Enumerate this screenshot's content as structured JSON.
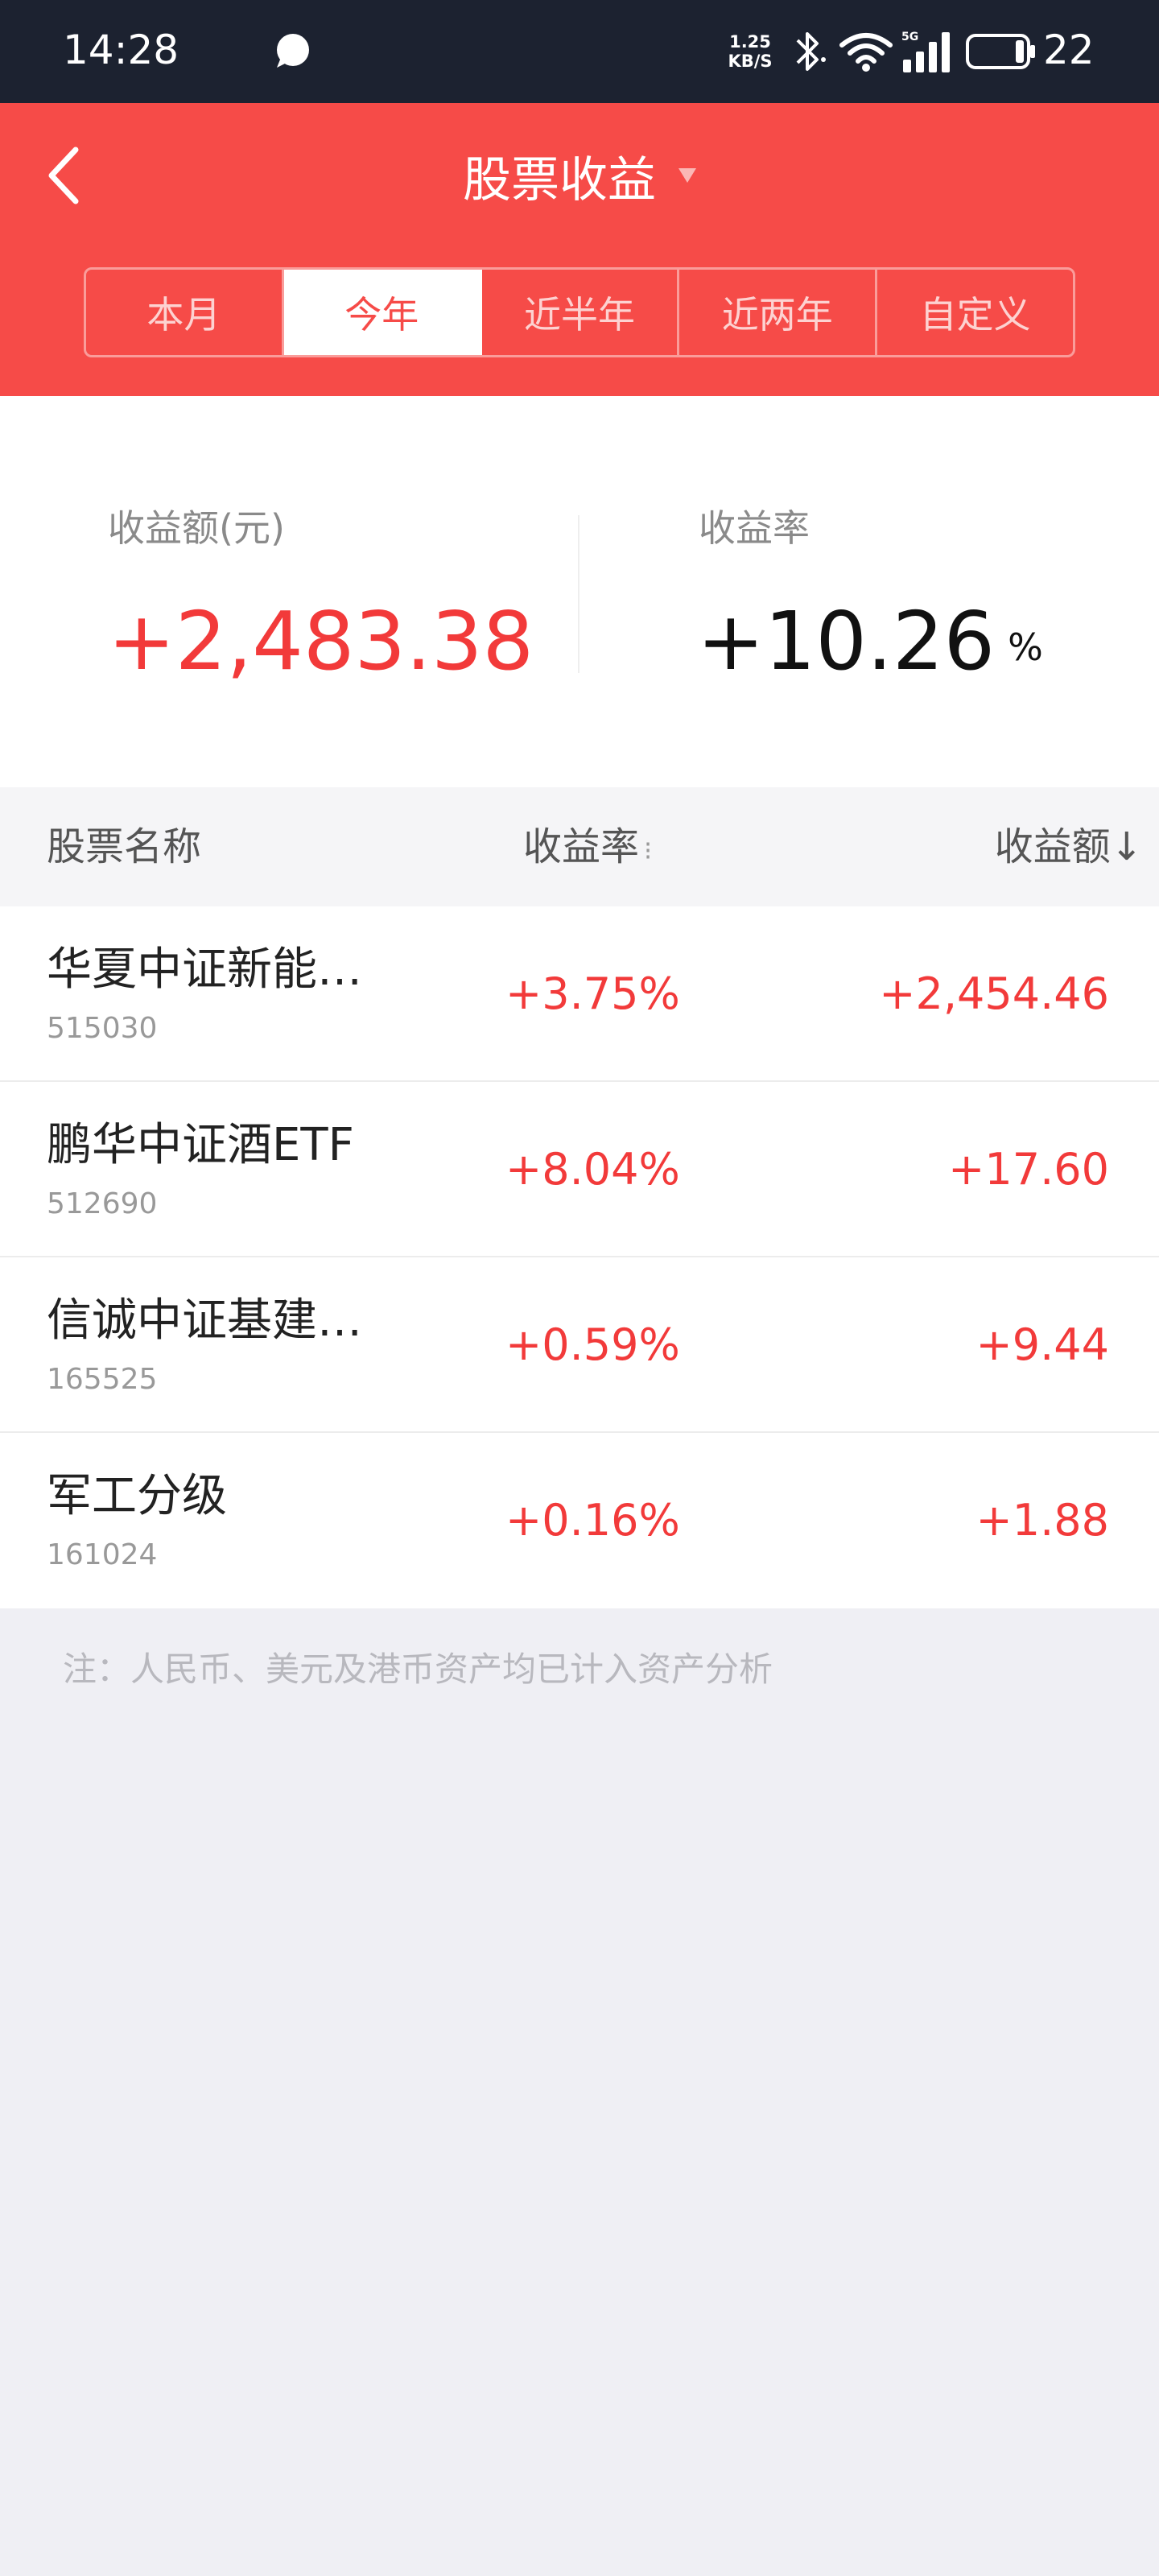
{
  "status_bar": {
    "time": "14:28",
    "net_speed_value": "1.25",
    "net_speed_unit": "KB/S",
    "signal_label": "5G",
    "battery_level": "22",
    "icons": [
      "chat-bubble-icon",
      "bluetooth-icon",
      "wifi-icon",
      "signal-icon",
      "battery-icon"
    ]
  },
  "header": {
    "title": "股票收益",
    "tabs": [
      {
        "label": "本月",
        "active": false
      },
      {
        "label": "今年",
        "active": true
      },
      {
        "label": "近半年",
        "active": false
      },
      {
        "label": "近两年",
        "active": false
      },
      {
        "label": "自定义",
        "active": false
      }
    ]
  },
  "summary": {
    "amount_label": "收益额(元)",
    "amount_value": "+2,483.38",
    "rate_label": "收益率",
    "rate_value": "+10.26",
    "rate_unit": "%"
  },
  "table": {
    "col_name": "股票名称",
    "col_rate": "收益率",
    "col_rate_sort": "⁝",
    "col_amount": "收益额↓",
    "rows": [
      {
        "name": "华夏中证新能…",
        "code": "515030",
        "rate": "+3.75%",
        "amount": "+2,454.46"
      },
      {
        "name": "鹏华中证酒ETF",
        "code": "512690",
        "rate": "+8.04%",
        "amount": "+17.60"
      },
      {
        "name": "信诚中证基建…",
        "code": "165525",
        "rate": "+0.59%",
        "amount": "+9.44"
      },
      {
        "name": "军工分级",
        "code": "161024",
        "rate": "+0.16%",
        "amount": "+1.88"
      }
    ]
  },
  "footnote": "注：人民币、美元及港币资产均已计入资产分析",
  "colors": {
    "accent": "#f64b48",
    "gain": "#f23a3a",
    "status_bar": "#1c2230",
    "background": "#efeff4"
  }
}
